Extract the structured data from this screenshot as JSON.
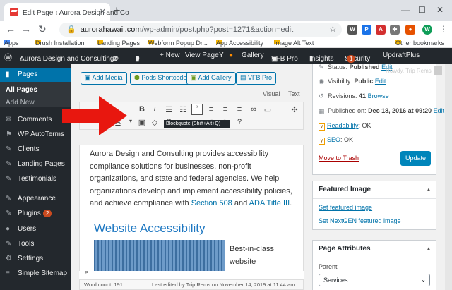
{
  "browser": {
    "tab_title": "Edit Page ‹ Aurora Design and Co",
    "url_host": "aurorahawaii.com",
    "url_path": "/wp-admin/post.php?post=1271&action=edit",
    "profile_initial": "W"
  },
  "bookmarks": [
    "Apps",
    "Drush Installation",
    "Landing Pages",
    "Webform Popup Dr...",
    "App Accessibility",
    "Image Alt Text",
    "Other bookmarks"
  ],
  "adminbar": {
    "site": "Aurora Design and Consulting",
    "updates": "2",
    "comments": "0",
    "new": "+ New",
    "view": "View Page",
    "gallery": "Gallery",
    "vfb": "VFB Pro",
    "insights": "Insights",
    "security": "Security",
    "security_count": "1",
    "updraft": "UpdraftPlus",
    "howdy": "Howdy, Trip Rems"
  },
  "sidebar": {
    "items": [
      {
        "label": "Pages",
        "icon": "▮"
      },
      {
        "label": "All Pages"
      },
      {
        "label": "Add New"
      },
      {
        "label": "Comments",
        "icon": "✉"
      },
      {
        "label": "WP AutoTerms",
        "icon": "⚑"
      },
      {
        "label": "Clients",
        "icon": "✎"
      },
      {
        "label": "Landing Pages",
        "icon": "✎"
      },
      {
        "label": "Testimonials",
        "icon": "✎"
      },
      {
        "label": "Appearance",
        "icon": "✎"
      },
      {
        "label": "Plugins",
        "icon": "✎",
        "badge": "2"
      },
      {
        "label": "Users",
        "icon": "●"
      },
      {
        "label": "Tools",
        "icon": "✎"
      },
      {
        "label": "Settings",
        "icon": "⚙"
      },
      {
        "label": "Simple Sitemap",
        "icon": "≡"
      }
    ]
  },
  "editor": {
    "buttons": [
      "Add Media",
      "Pods Shortcode",
      "Add Gallery",
      "VFB Pro"
    ],
    "tab_visual": "Visual",
    "tab_text": "Text",
    "tooltip": "Blockquote (Shift+Alt+Q)",
    "para_text_1": "Aurora Design and Consulting provides accessibility compliance solutions for businesses, non-profit organizations, and state and federal agencies. We help organizations develop and implement accessibility policies, and achieve compliance with ",
    "para_link_1": "Section 508",
    "para_text_2": " and ",
    "para_link_2": "ADA Title III",
    "para_text_3": ".",
    "heading": "Website Accessibility",
    "side_text_1": "Best-in-class",
    "side_text_2": "website",
    "path": "P",
    "word_count": "Word count: 191",
    "last_edited": "Last edited by Trip Rems on November 14, 2019 at 11:44 am"
  },
  "publish": {
    "status_label": "Status:",
    "status_value": "Published",
    "visibility_label": "Visibility:",
    "visibility_value": "Public",
    "revisions_label": "Revisions:",
    "revisions_value": "41",
    "browse": "Browse",
    "published_label": "Published on:",
    "published_value": "Dec 18, 2016 at 09:20",
    "edit": "Edit",
    "readability_label": "Readability",
    "readability_value": ": OK",
    "seo_label": "SEO",
    "seo_value": ": OK",
    "trash": "Move to Trash",
    "update": "Update"
  },
  "featured": {
    "title": "Featured Image",
    "set": "Set featured image",
    "set_nextgen": "Set NextGEN featured image"
  },
  "attributes": {
    "title": "Page Attributes",
    "parent_label": "Parent",
    "parent_value": "Services"
  },
  "colors": {
    "wp_blue": "#0073aa",
    "admin_dark": "#23282d",
    "arrow_red": "#e8170f"
  }
}
